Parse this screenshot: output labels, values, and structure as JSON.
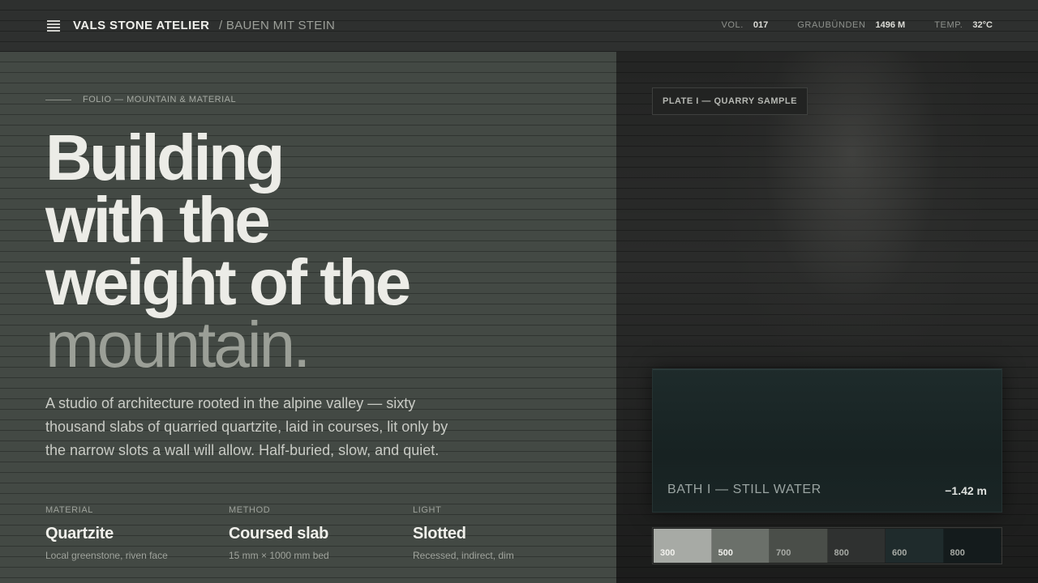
{
  "header": {
    "brand": "VALS STONE ATELIER",
    "subtitle": "/ BAUEN MIT STEIN",
    "stats": [
      {
        "label": "VOL.",
        "value": "017"
      },
      {
        "label": "GRAUBÜNDEN",
        "value": "1496 M"
      },
      {
        "label": "TEMP.",
        "value": "32°C"
      }
    ]
  },
  "hero": {
    "folio": "FOLIO — MOUNTAIN & MATERIAL",
    "headline_lines": [
      "Building",
      "with the",
      "weight of the"
    ],
    "headline_light": "mountain.",
    "intro": "A studio of architecture rooted in the alpine valley — sixty thousand slabs of quarried quartzite, laid in courses, lit only by the narrow slots a wall will allow. Half-buried, slow, and quiet."
  },
  "specs": [
    {
      "label": "MATERIAL",
      "value": "Quartzite",
      "note": "Local greenstone, riven face"
    },
    {
      "label": "METHOD",
      "value": "Coursed slab",
      "note": "15 mm × 1000 mm bed"
    },
    {
      "label": "LIGHT",
      "value": "Slotted",
      "note": "Recessed, indirect, dim"
    }
  ],
  "plate": {
    "tag": "PLATE I — QUARRY SAMPLE",
    "bath_label": "BATH I — STILL WATER",
    "bath_depth": "−1.42 m"
  },
  "swatches": [
    {
      "label": "300",
      "color": "#a7aaa5",
      "text_color": "#f2f2ee"
    },
    {
      "label": "500",
      "color": "#6b706a",
      "text_color": "#f2f2ee"
    },
    {
      "label": "700",
      "color": "#4a4e49",
      "text_color": "#a7aaa5"
    },
    {
      "label": "800",
      "color": "#2f3130",
      "text_color": "#a7aaa5"
    },
    {
      "label": "600",
      "color": "#1f2b2c",
      "text_color": "#a7aaa5"
    },
    {
      "label": "800",
      "color": "#141b1c",
      "text_color": "#a7aaa5"
    }
  ]
}
